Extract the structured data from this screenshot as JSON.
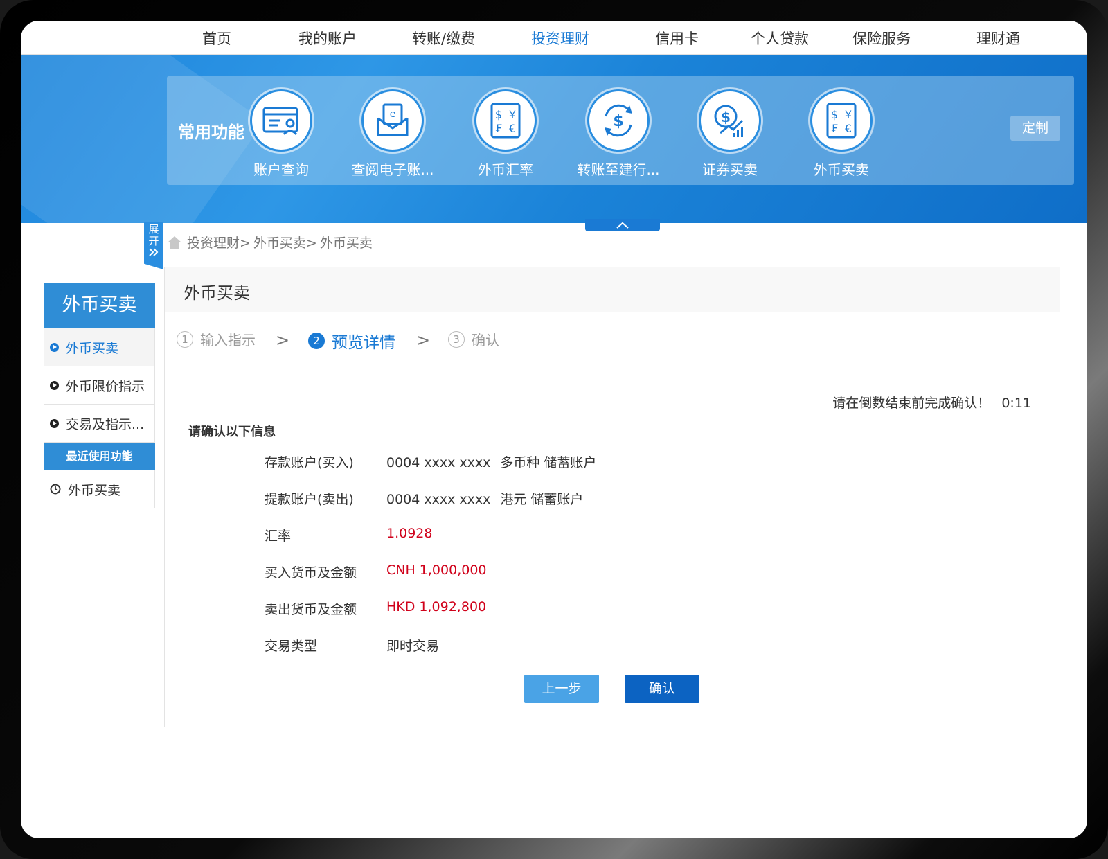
{
  "nav": {
    "items": [
      "首页",
      "我的账户",
      "转账/缴费",
      "投资理财",
      "信用卡",
      "个人贷款",
      "保险服务",
      "理财通"
    ],
    "active_index": 3
  },
  "quick": {
    "title": "常用功能",
    "items": [
      {
        "label": "账户查询",
        "icon": "account-card-icon"
      },
      {
        "label": "查阅电子账...",
        "icon": "e-statement-envelope-icon"
      },
      {
        "label": "外币汇率",
        "icon": "currency-symbols-icon"
      },
      {
        "label": "转账至建行...",
        "icon": "dollar-transfer-icon"
      },
      {
        "label": "证券买卖",
        "icon": "securities-chart-icon"
      },
      {
        "label": "外币买卖",
        "icon": "currency-symbols-icon"
      }
    ],
    "customize_label": "定制"
  },
  "expand_tab": {
    "line1": "展",
    "line2": "开"
  },
  "sidebar": {
    "title": "外币买卖",
    "items": [
      {
        "label": "外币买卖",
        "active": true
      },
      {
        "label": "外币限价指示",
        "active": false
      },
      {
        "label": "交易及指示...",
        "active": false
      }
    ],
    "recent_title": "最近使用功能",
    "recent_items": [
      {
        "label": "外币买卖"
      }
    ]
  },
  "breadcrumb": [
    "投资理财>",
    "外币买卖>",
    "外币买卖"
  ],
  "panel": {
    "title": "外币买卖"
  },
  "steps": [
    {
      "num": "1",
      "label": "输入指示",
      "active": false
    },
    {
      "num": "2",
      "label": "预览详情",
      "active": true
    },
    {
      "num": "3",
      "label": "确认",
      "active": false
    }
  ],
  "countdown": {
    "text": "请在倒数结束前完成确认！",
    "time": "0:11"
  },
  "confirm": {
    "heading": "请确认以下信息",
    "rows": [
      {
        "label": "存款账户(买入)",
        "value": "0004 xxxx xxxx",
        "sub": "多币种 储蓄账户"
      },
      {
        "label": "提款账户(卖出)",
        "value": "0004 xxxx xxxx",
        "sub": "港元 储蓄账户"
      },
      {
        "label": "汇率",
        "value": "1.0928"
      },
      {
        "label": "买入货币及金额",
        "value": "CNH 1,000,000"
      },
      {
        "label": "卖出货币及金额",
        "value": "HKD 1,092,800"
      },
      {
        "label": "交易类型",
        "value": "即时交易"
      }
    ]
  },
  "buttons": {
    "prev": "上一步",
    "confirm": "确认"
  },
  "colors": {
    "accent": "#1a7ad4",
    "highlight_red": "#d0021b",
    "sidebar_blue": "#2f8dd6"
  }
}
